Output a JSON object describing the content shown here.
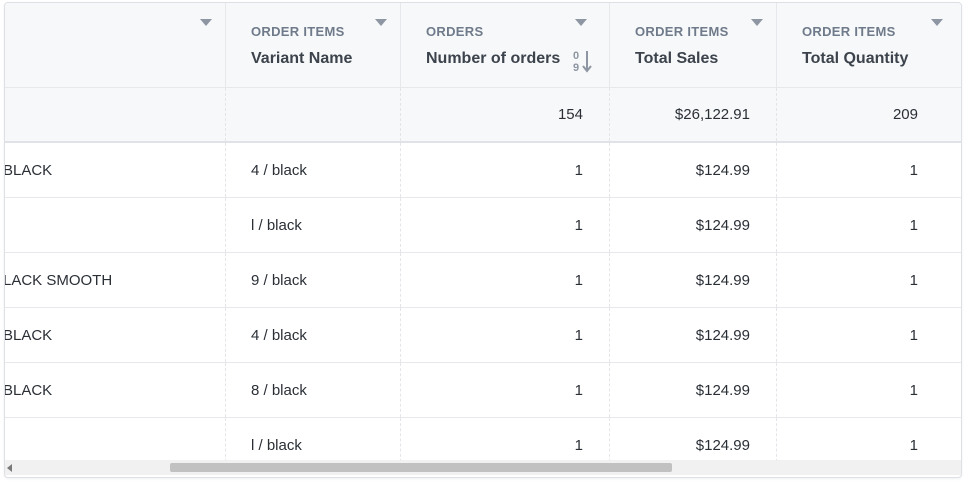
{
  "columns": [
    {
      "group": "",
      "name": ""
    },
    {
      "group": "ORDER ITEMS",
      "name": "Variant Name"
    },
    {
      "group": "ORDERS",
      "name": "Number of orders"
    },
    {
      "group": "ORDER ITEMS",
      "name": "Total Sales"
    },
    {
      "group": "ORDER ITEMS",
      "name": "Total Quantity"
    }
  ],
  "sort": {
    "column": "Number of orders",
    "icon": "sort-numeric-desc-icon"
  },
  "totals": {
    "orders": "154",
    "sales": "$26,122.91",
    "quantity": "209"
  },
  "rows": [
    {
      "product": "BLACK",
      "variant": "4 / black",
      "orders": "1",
      "sales": "$124.99",
      "quantity": "1"
    },
    {
      "product": "",
      "variant": "l / black",
      "orders": "1",
      "sales": "$124.99",
      "quantity": "1"
    },
    {
      "product": "LACK SMOOTH",
      "variant": "9 / black",
      "orders": "1",
      "sales": "$124.99",
      "quantity": "1"
    },
    {
      "product": "BLACK",
      "variant": "4 / black",
      "orders": "1",
      "sales": "$124.99",
      "quantity": "1"
    },
    {
      "product": "BLACK",
      "variant": "8 / black",
      "orders": "1",
      "sales": "$124.99",
      "quantity": "1"
    },
    {
      "product": "",
      "variant": "l / black",
      "orders": "1",
      "sales": "$124.99",
      "quantity": "1"
    }
  ],
  "colors": {
    "header_bg": "#f7f8f9",
    "group_label": "#6f7a8a",
    "text": "#2a2f36"
  }
}
